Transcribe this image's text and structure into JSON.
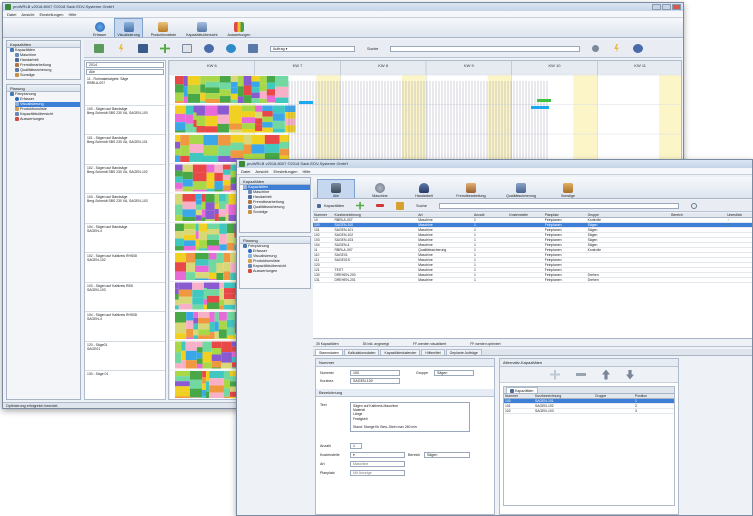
{
  "window1": {
    "title": "proWRLB v2018.8007 ©2018 Sack EDV-Systeme GmbH",
    "menu": [
      "Datei",
      "Ansicht",
      "Einstellungen",
      "Hilfe"
    ],
    "ribbon": [
      "Erfasser",
      "Visualisierung",
      "Produktionsliste",
      "Kapazitätsübersicht",
      "Auswertungen"
    ],
    "nav_header": "Kapazitäten",
    "nav_items": [
      "Kapazitäten",
      "Maschine",
      "Handarbeit",
      "Fremdbearbeitung",
      "Qualitätssicherung",
      "Sonstige"
    ],
    "plan_header": "Planung",
    "plan_items": [
      "Feinplanung",
      "Erfasser",
      "Visualisierung",
      "Produktionsliste",
      "Kapazitätsübersicht",
      "Auswertungen"
    ],
    "toolbar_select": "Auftrag",
    "search_label": "Suche",
    "date_field": "2014",
    "filter_field": "Alle",
    "week_labels": [
      "KW 6",
      "KW 7",
      "KW 8",
      "KW 9",
      "KW 10",
      "KW 11"
    ],
    "machines": [
      {
        "id": "11",
        "name": "Rohmaterialgebr. Säge",
        "sub": "RBRLA-007"
      },
      {
        "id": "100",
        "name": "Sägen auf Bandsäge",
        "sub": "Berg-Schmidt SBS 230 VA, SAGEN-100"
      },
      {
        "id": "101",
        "name": "Sägen auf Bandsäge",
        "sub": "Berg-Schmidt SBS 230 VA, SAGEN-101"
      },
      {
        "id": "102",
        "name": "Sägen auf Bandsäge",
        "sub": "Berg-Schmidt SBS 230 VA, SAGEN-102"
      },
      {
        "id": "103",
        "name": "Sägen auf Bandsäge",
        "sub": "Berg-Schmidt SBS 230 VA, SAGEN-103"
      },
      {
        "id": "104",
        "name": "Sägen auf Bandsäge",
        "sub": "SAGEN-4"
      },
      {
        "id": "102",
        "name": "Sägen auf Kaltkreis RHS08",
        "sub": "SAGEN-102"
      },
      {
        "id": "103",
        "name": "Sägen auf Kaltkreis RBS",
        "sub": "SAGEN-103"
      },
      {
        "id": "104",
        "name": "Sägen auf Kaltkreis RHS08",
        "sub": "SAGEN-4"
      },
      {
        "id": "120",
        "name": "Säge01",
        "sub": "SAGE01"
      },
      {
        "id": "130",
        "name": "Säge 01",
        "sub": ""
      }
    ],
    "footer_value": "0,00:030.004",
    "status": "Optimierung erfolgreich beendet."
  },
  "window2": {
    "title": "proWRLB v2018.8007 ©2018 Sack EDV-Systeme GmbH",
    "menu": [
      "Datei",
      "Ansicht",
      "Einstellungen",
      "Hilfe"
    ],
    "ribbon": [
      "Alle",
      "Maschine",
      "Handarbeit",
      "Fremdbearbeitung",
      "Qualitätssicherung",
      "Sonstige"
    ],
    "nav_header": "Kapazitäten",
    "nav_items": [
      "Kapazitäten",
      "Maschine",
      "Handarbeit",
      "Fremdbearbeitung",
      "Qualitätssicherung",
      "Sonstige"
    ],
    "plan_header": "Planung",
    "plan_items": [
      "Feinplanung",
      "Erfasser",
      "Visualisierung",
      "Produktionsliste",
      "Kapazitätsübersicht",
      "Auswertungen"
    ],
    "toolbar_tab": "Kapazitäten",
    "search_label": "Suche",
    "columns": [
      "Nummer",
      "Kurzbezeichnung",
      "Art",
      "Anzahl",
      "Kostenstelle",
      "Planplatz",
      "Gruppe",
      "Bereich",
      "Unendlich"
    ],
    "rows": [
      [
        "10",
        "RBRLA-007",
        "Maschine",
        "1",
        "",
        "Feinplanen",
        "Kontrolle",
        ""
      ],
      [
        "100",
        "SAGEN-100",
        "Maschine",
        "1",
        "",
        "Feinplanen",
        "Sägen",
        ""
      ],
      [
        "101",
        "SAGEN-101",
        "Maschine",
        "1",
        "",
        "Feinplanen",
        "Sägen",
        ""
      ],
      [
        "102",
        "SAGEN-102",
        "Maschine",
        "1",
        "",
        "Feinplanen",
        "Sägen",
        ""
      ],
      [
        "103",
        "SAGEN-103",
        "Maschine",
        "1",
        "",
        "Feinplanen",
        "Sägen",
        ""
      ],
      [
        "104",
        "SAGEN-4",
        "Maschine",
        "1",
        "",
        "Feinplanen",
        "Sägen",
        ""
      ],
      [
        "11",
        "RBRLA-007",
        "Qualitätssicherung",
        "1",
        "",
        "Feinplanen",
        "Kontrolle",
        ""
      ],
      [
        "110",
        "SAGE01",
        "Maschine",
        "1",
        "",
        "Feinplanen",
        "",
        ""
      ],
      [
        "111",
        "SAGE01S",
        "Maschine",
        "1",
        "",
        "Feinplanen",
        "",
        ""
      ],
      [
        "120",
        "",
        "Maschine",
        "1",
        "",
        "Feinplanen",
        "",
        ""
      ],
      [
        "121",
        "TEST",
        "Maschine",
        "1",
        "",
        "Feinplanen",
        "",
        ""
      ],
      [
        "130",
        "DREHEN-200",
        "Maschine",
        "1",
        "",
        "Feinplanen",
        "Drehen",
        ""
      ],
      [
        "131",
        "DREHEN-201",
        "Maschine",
        "1",
        "",
        "Feinplanen",
        "Drehen",
        ""
      ]
    ],
    "selected_row": 1,
    "summary": [
      "35 Kapazitäten",
      "35 inkl. angezeigt",
      "FF-werden visualisiert",
      "FF-werden optimiert"
    ],
    "detail_tabs": [
      "Stammdaten",
      "Kalkulationsdaten",
      "Kapazitätenkalender",
      "Hilfsmittel",
      "Geplante Aufträge"
    ],
    "section_nummer": "Nummer",
    "nummer_label": "Nummer",
    "nummer_value": "100",
    "gruppe_label": "Gruppe",
    "gruppe_value": "Sägen",
    "kurzbez_label": "Kurzbez.",
    "kurzbez_value": "SAGEN-100",
    "section_bezeichnung": "Bezeichnung",
    "text_label": "Text",
    "text_value": "Sägen auf Kaltkreis-Maschine\nMaterial\nLänge\nFestigkeit\n\nStand: Stange für Bew.-Stein max 260 mm",
    "anzahl_label": "Anzahl",
    "anzahl_value": "1",
    "kostenstelle_label": "Kostenstelle",
    "bereich_label": "Bereich",
    "bereich_value": "Sägen",
    "art_label": "Art",
    "art_value": "Maschine",
    "planplatz_label": "Planplatz",
    "planplatz_value": "Mit Anzeige",
    "alt_header": "Alternativ-Kapazitäten",
    "alt_tab": "Kapazitäten",
    "alt_columns": [
      "Nummer",
      "Kurzbezeichnung",
      "Gruppe",
      "Position"
    ],
    "alt_rows": [
      [
        "100",
        "SAGEN-101",
        "",
        "1"
      ],
      [
        "101",
        "SAGEN-102",
        "",
        "2"
      ],
      [
        "102",
        "SAGEN-103",
        "",
        "3"
      ]
    ]
  },
  "colors": {
    "accent": "#3d7fd6",
    "ribbon": "#dde5ef"
  }
}
